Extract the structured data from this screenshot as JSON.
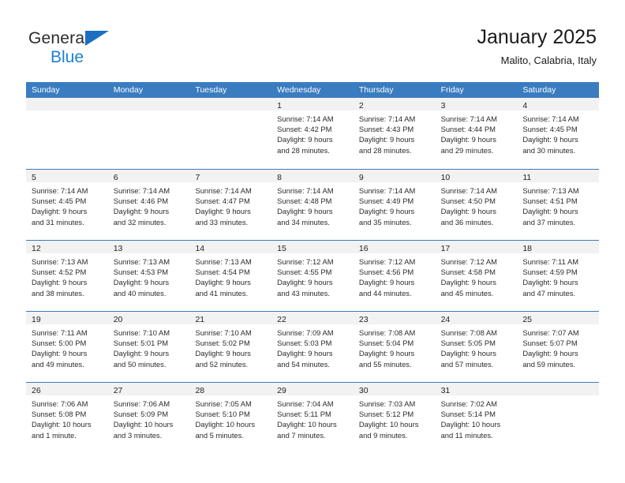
{
  "brand": {
    "name_part1": "General",
    "name_part2": "Blue",
    "logo_icon": "triangle-logo-icon",
    "accent_color": "#1b6ec2",
    "blue_text_color": "#1b7fd4"
  },
  "header": {
    "title": "January 2025",
    "subtitle": "Malito, Calabria, Italy"
  },
  "theme": {
    "header_row_bg": "#3a7cc0",
    "daynum_band_bg": "#f2f2f2",
    "grid_line": "#3a7cc0",
    "text": "#2b2b2b"
  },
  "weekdays": [
    "Sunday",
    "Monday",
    "Tuesday",
    "Wednesday",
    "Thursday",
    "Friday",
    "Saturday"
  ],
  "weeks": [
    [
      {
        "day": "",
        "lines": []
      },
      {
        "day": "",
        "lines": []
      },
      {
        "day": "",
        "lines": []
      },
      {
        "day": "1",
        "lines": [
          "Sunrise: 7:14 AM",
          "Sunset: 4:42 PM",
          "Daylight: 9 hours",
          "and 28 minutes."
        ]
      },
      {
        "day": "2",
        "lines": [
          "Sunrise: 7:14 AM",
          "Sunset: 4:43 PM",
          "Daylight: 9 hours",
          "and 28 minutes."
        ]
      },
      {
        "day": "3",
        "lines": [
          "Sunrise: 7:14 AM",
          "Sunset: 4:44 PM",
          "Daylight: 9 hours",
          "and 29 minutes."
        ]
      },
      {
        "day": "4",
        "lines": [
          "Sunrise: 7:14 AM",
          "Sunset: 4:45 PM",
          "Daylight: 9 hours",
          "and 30 minutes."
        ]
      }
    ],
    [
      {
        "day": "5",
        "lines": [
          "Sunrise: 7:14 AM",
          "Sunset: 4:45 PM",
          "Daylight: 9 hours",
          "and 31 minutes."
        ]
      },
      {
        "day": "6",
        "lines": [
          "Sunrise: 7:14 AM",
          "Sunset: 4:46 PM",
          "Daylight: 9 hours",
          "and 32 minutes."
        ]
      },
      {
        "day": "7",
        "lines": [
          "Sunrise: 7:14 AM",
          "Sunset: 4:47 PM",
          "Daylight: 9 hours",
          "and 33 minutes."
        ]
      },
      {
        "day": "8",
        "lines": [
          "Sunrise: 7:14 AM",
          "Sunset: 4:48 PM",
          "Daylight: 9 hours",
          "and 34 minutes."
        ]
      },
      {
        "day": "9",
        "lines": [
          "Sunrise: 7:14 AM",
          "Sunset: 4:49 PM",
          "Daylight: 9 hours",
          "and 35 minutes."
        ]
      },
      {
        "day": "10",
        "lines": [
          "Sunrise: 7:14 AM",
          "Sunset: 4:50 PM",
          "Daylight: 9 hours",
          "and 36 minutes."
        ]
      },
      {
        "day": "11",
        "lines": [
          "Sunrise: 7:13 AM",
          "Sunset: 4:51 PM",
          "Daylight: 9 hours",
          "and 37 minutes."
        ]
      }
    ],
    [
      {
        "day": "12",
        "lines": [
          "Sunrise: 7:13 AM",
          "Sunset: 4:52 PM",
          "Daylight: 9 hours",
          "and 38 minutes."
        ]
      },
      {
        "day": "13",
        "lines": [
          "Sunrise: 7:13 AM",
          "Sunset: 4:53 PM",
          "Daylight: 9 hours",
          "and 40 minutes."
        ]
      },
      {
        "day": "14",
        "lines": [
          "Sunrise: 7:13 AM",
          "Sunset: 4:54 PM",
          "Daylight: 9 hours",
          "and 41 minutes."
        ]
      },
      {
        "day": "15",
        "lines": [
          "Sunrise: 7:12 AM",
          "Sunset: 4:55 PM",
          "Daylight: 9 hours",
          "and 43 minutes."
        ]
      },
      {
        "day": "16",
        "lines": [
          "Sunrise: 7:12 AM",
          "Sunset: 4:56 PM",
          "Daylight: 9 hours",
          "and 44 minutes."
        ]
      },
      {
        "day": "17",
        "lines": [
          "Sunrise: 7:12 AM",
          "Sunset: 4:58 PM",
          "Daylight: 9 hours",
          "and 45 minutes."
        ]
      },
      {
        "day": "18",
        "lines": [
          "Sunrise: 7:11 AM",
          "Sunset: 4:59 PM",
          "Daylight: 9 hours",
          "and 47 minutes."
        ]
      }
    ],
    [
      {
        "day": "19",
        "lines": [
          "Sunrise: 7:11 AM",
          "Sunset: 5:00 PM",
          "Daylight: 9 hours",
          "and 49 minutes."
        ]
      },
      {
        "day": "20",
        "lines": [
          "Sunrise: 7:10 AM",
          "Sunset: 5:01 PM",
          "Daylight: 9 hours",
          "and 50 minutes."
        ]
      },
      {
        "day": "21",
        "lines": [
          "Sunrise: 7:10 AM",
          "Sunset: 5:02 PM",
          "Daylight: 9 hours",
          "and 52 minutes."
        ]
      },
      {
        "day": "22",
        "lines": [
          "Sunrise: 7:09 AM",
          "Sunset: 5:03 PM",
          "Daylight: 9 hours",
          "and 54 minutes."
        ]
      },
      {
        "day": "23",
        "lines": [
          "Sunrise: 7:08 AM",
          "Sunset: 5:04 PM",
          "Daylight: 9 hours",
          "and 55 minutes."
        ]
      },
      {
        "day": "24",
        "lines": [
          "Sunrise: 7:08 AM",
          "Sunset: 5:05 PM",
          "Daylight: 9 hours",
          "and 57 minutes."
        ]
      },
      {
        "day": "25",
        "lines": [
          "Sunrise: 7:07 AM",
          "Sunset: 5:07 PM",
          "Daylight: 9 hours",
          "and 59 minutes."
        ]
      }
    ],
    [
      {
        "day": "26",
        "lines": [
          "Sunrise: 7:06 AM",
          "Sunset: 5:08 PM",
          "Daylight: 10 hours",
          "and 1 minute."
        ]
      },
      {
        "day": "27",
        "lines": [
          "Sunrise: 7:06 AM",
          "Sunset: 5:09 PM",
          "Daylight: 10 hours",
          "and 3 minutes."
        ]
      },
      {
        "day": "28",
        "lines": [
          "Sunrise: 7:05 AM",
          "Sunset: 5:10 PM",
          "Daylight: 10 hours",
          "and 5 minutes."
        ]
      },
      {
        "day": "29",
        "lines": [
          "Sunrise: 7:04 AM",
          "Sunset: 5:11 PM",
          "Daylight: 10 hours",
          "and 7 minutes."
        ]
      },
      {
        "day": "30",
        "lines": [
          "Sunrise: 7:03 AM",
          "Sunset: 5:12 PM",
          "Daylight: 10 hours",
          "and 9 minutes."
        ]
      },
      {
        "day": "31",
        "lines": [
          "Sunrise: 7:02 AM",
          "Sunset: 5:14 PM",
          "Daylight: 10 hours",
          "and 11 minutes."
        ]
      },
      {
        "day": "",
        "lines": []
      }
    ]
  ]
}
